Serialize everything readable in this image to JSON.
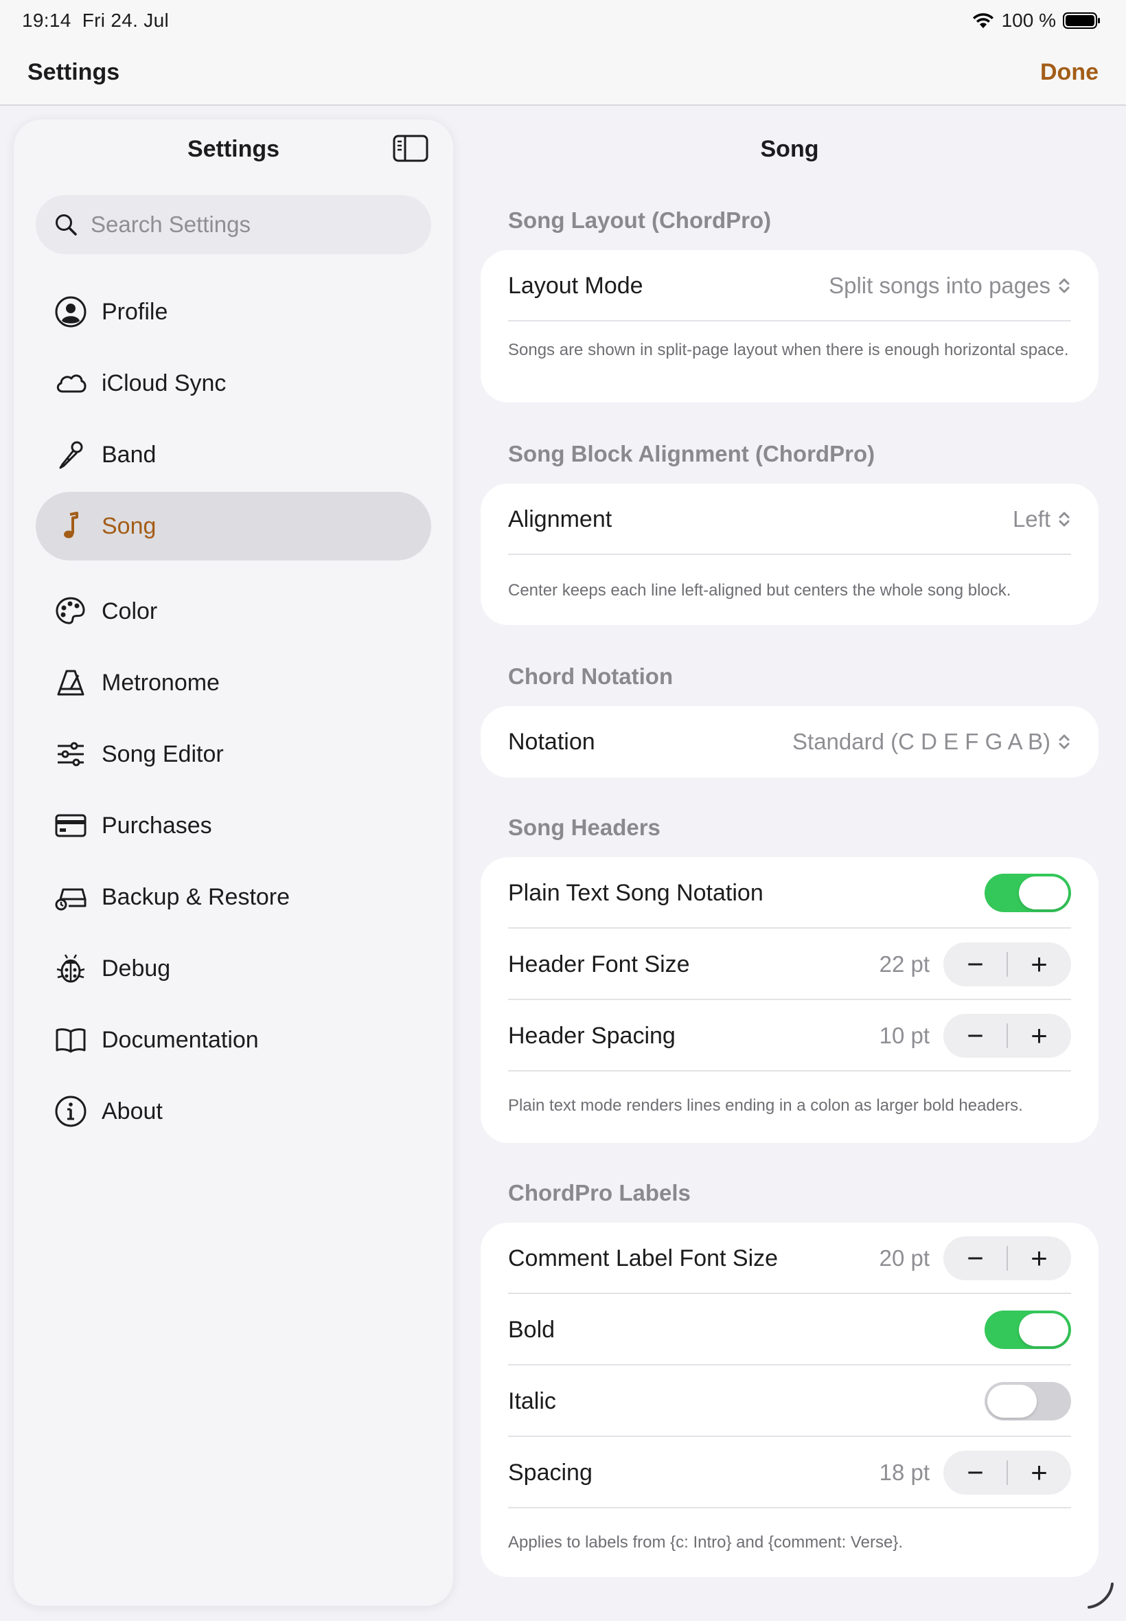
{
  "status": {
    "time": "19:14",
    "date": "Fri 24. Jul",
    "battery": "100 %"
  },
  "topnav": {
    "title": "Settings",
    "done_label": "Done"
  },
  "sidebar": {
    "title": "Settings",
    "search_placeholder": "Search Settings",
    "items": [
      {
        "label": "Profile",
        "icon": "profile-icon"
      },
      {
        "label": "iCloud Sync",
        "icon": "cloud-icon"
      },
      {
        "label": "Band",
        "icon": "microphone-icon"
      },
      {
        "label": "Song",
        "icon": "music-note-icon",
        "active": true
      },
      {
        "label": "Color",
        "icon": "palette-icon"
      },
      {
        "label": "Metronome",
        "icon": "metronome-icon"
      },
      {
        "label": "Song Editor",
        "icon": "sliders-icon"
      },
      {
        "label": "Purchases",
        "icon": "credit-card-icon"
      },
      {
        "label": "Backup & Restore",
        "icon": "backup-drive-icon"
      },
      {
        "label": "Debug",
        "icon": "ladybug-icon"
      },
      {
        "label": "Documentation",
        "icon": "book-icon"
      },
      {
        "label": "About",
        "icon": "info-icon"
      }
    ]
  },
  "detail": {
    "title": "Song",
    "layout": {
      "header": "Song Layout (ChordPro)",
      "label": "Layout Mode",
      "value": "Split songs into pages",
      "footnote": "Songs are shown in split-page layout when there is enough horizontal space."
    },
    "alignment": {
      "header": "Song Block Alignment (ChordPro)",
      "label": "Alignment",
      "value": "Left",
      "footnote": "Center keeps each line left-aligned but centers the whole song block."
    },
    "chords": {
      "header": "Chord Notation",
      "label": "Notation",
      "value": "Standard (C D E F G A B)"
    },
    "headers": {
      "header": "Song Headers",
      "plain_text_label": "Plain Text Song Notation",
      "plain_text_on": true,
      "font_size_label": "Header Font Size",
      "font_size_value": "22 pt",
      "spacing_label": "Header Spacing",
      "spacing_value": "10 pt",
      "footnote": "Plain text mode renders lines ending in a colon as larger bold headers."
    },
    "labels": {
      "header": "ChordPro Labels",
      "font_size_label": "Comment Label Font Size",
      "font_size_value": "20 pt",
      "bold_label": "Bold",
      "bold_on": true,
      "italic_label": "Italic",
      "italic_on": false,
      "spacing_label": "Spacing",
      "spacing_value": "18 pt",
      "footnote": "Applies to labels from {c: Intro} and {comment: Verse}."
    },
    "stepper": {
      "minus": "−",
      "plus": "+"
    }
  },
  "colors": {
    "accent": "#a35d17",
    "toggle_on": "#34c759",
    "toggle_off": "#d1d1d6"
  }
}
